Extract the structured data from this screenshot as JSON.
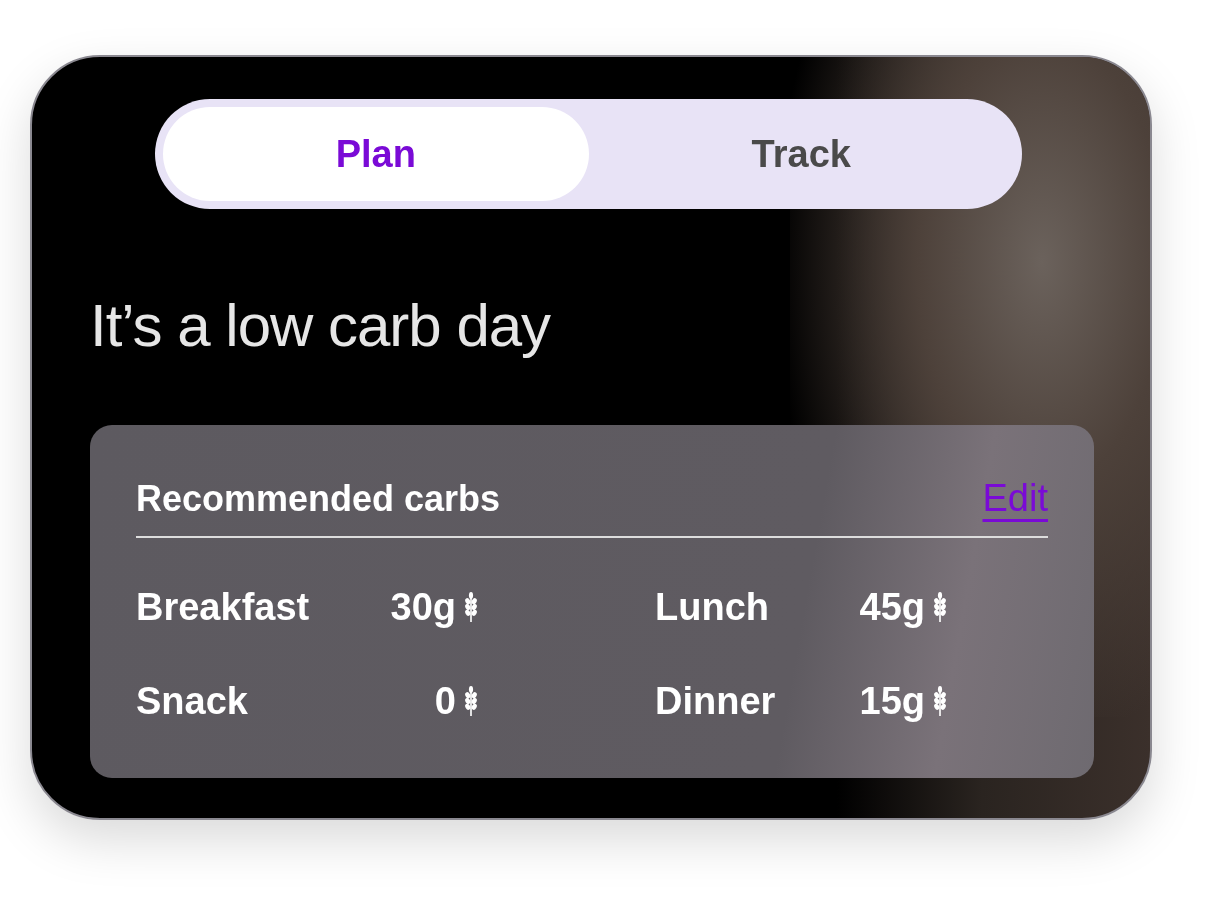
{
  "tabs": [
    {
      "label": "Plan",
      "selected": true
    },
    {
      "label": "Track",
      "selected": false
    }
  ],
  "heading": "It’s a low carb day",
  "panel": {
    "title": "Recommended carbs",
    "edit_link": "Edit",
    "meals": [
      {
        "name": "Breakfast",
        "amount": "30g"
      },
      {
        "name": "Lunch",
        "amount": "45g"
      },
      {
        "name": "Snack",
        "amount": "0"
      },
      {
        "name": "Dinner",
        "amount": "15g"
      }
    ]
  }
}
